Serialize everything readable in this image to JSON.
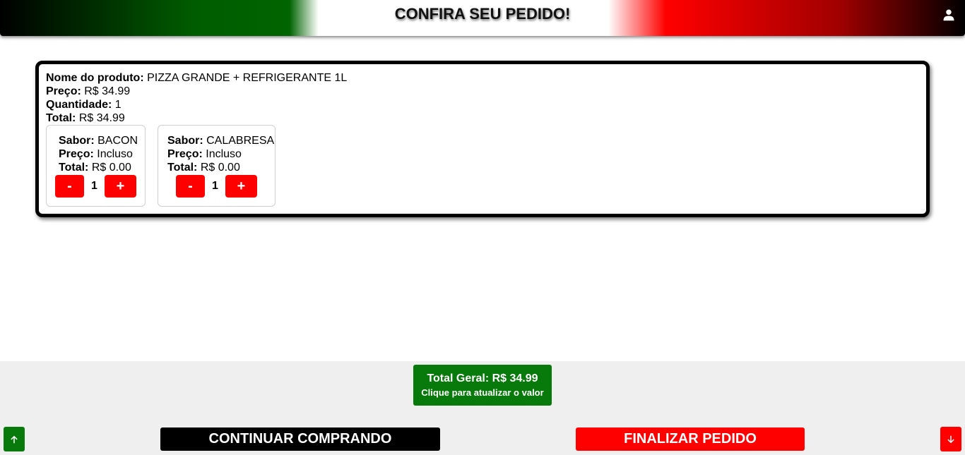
{
  "header": {
    "title": "CONFIRA SEU PEDIDO!",
    "user_icon": "user-icon"
  },
  "cart": {
    "item": {
      "name_label": "Nome do produto:",
      "name_value": "PIZZA GRANDE + REFRIGERANTE 1L",
      "price_label": "Preço:",
      "price_value": "R$ 34.99",
      "quantity_label": "Quantidade:",
      "quantity_value": "1",
      "total_label": "Total:",
      "total_value": "R$ 34.99"
    },
    "flavors": [
      {
        "flavor_label": "Sabor:",
        "flavor_value": "BACON",
        "price_label": "Preço:",
        "price_value": "Incluso",
        "total_label": "Total:",
        "total_value": "R$ 0.00",
        "minus_label": "-",
        "qty": "1",
        "plus_label": "+"
      },
      {
        "flavor_label": "Sabor:",
        "flavor_value": "CALABRESA",
        "price_label": "Preço:",
        "price_value": "Incluso",
        "total_label": "Total:",
        "total_value": "R$ 0.00",
        "minus_label": "-",
        "qty": "1",
        "plus_label": "+"
      }
    ]
  },
  "footer": {
    "grand_total": "Total Geral: R$ 34.99",
    "update_hint": "Clique para atualizar o valor",
    "continue_label": "CONTINUAR COMPRANDO",
    "finish_label": "FINALIZAR PEDIDO",
    "scroll_up_icon": "arrow-up-icon",
    "scroll_down_icon": "arrow-down-icon"
  },
  "colors": {
    "green": "#087a0b",
    "red": "#ff0000",
    "black": "#000000",
    "footer_bg": "#efefef"
  }
}
